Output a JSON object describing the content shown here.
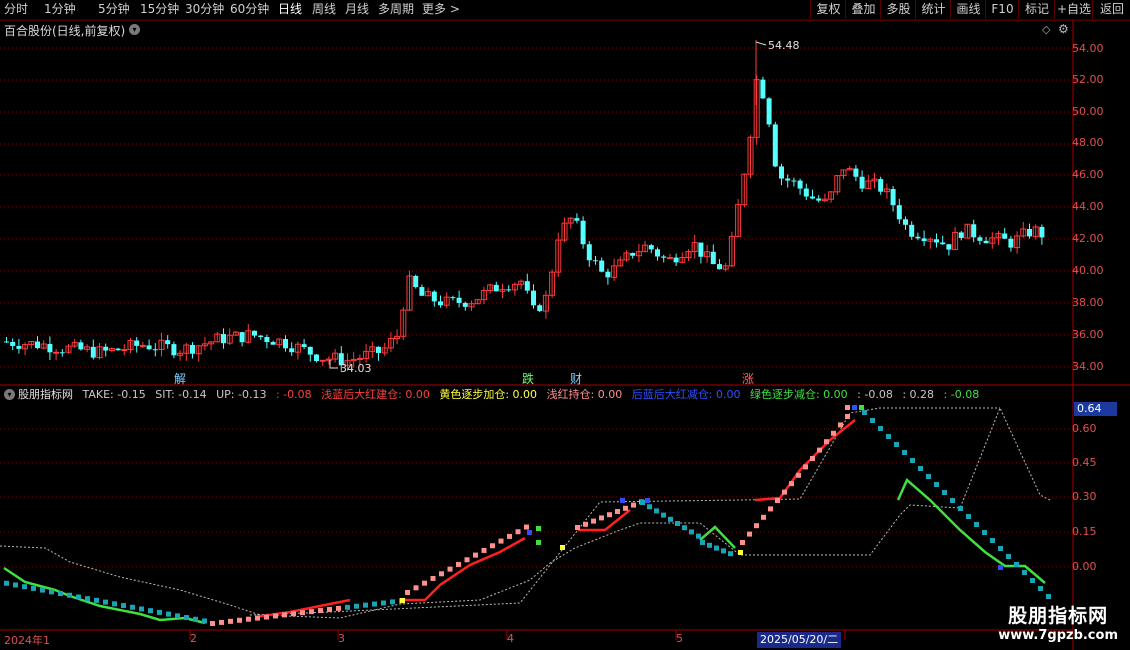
{
  "toolbar": {
    "periods": [
      "分时",
      "1分钟",
      "5分钟",
      "15分钟",
      "30分钟",
      "60分钟",
      "日线",
      "周线",
      "月线",
      "多周期",
      "更多 >"
    ],
    "buttons": [
      "复权",
      "叠加",
      "多股",
      "统计",
      "画线",
      "F10",
      "标记",
      "+自选",
      "返回"
    ]
  },
  "stock": {
    "title": "百合股份(日线,前复权)"
  },
  "price_axis": {
    "labels": [
      "54.00",
      "52.00",
      "50.00",
      "48.00",
      "46.00",
      "44.00",
      "42.00",
      "40.00",
      "38.00",
      "36.00",
      "34.00"
    ]
  },
  "indicator_axis": {
    "labels": [
      "0.60",
      "0.45",
      "0.30",
      "0.15",
      "0.00"
    ],
    "current": "0.64"
  },
  "annotations": {
    "high": "54.48",
    "low": "34.03"
  },
  "markers": [
    {
      "text": "解",
      "color": "#7fd0ff"
    },
    {
      "text": "跌",
      "color": "#70ff70"
    },
    {
      "text": "财",
      "color": "#7fd0ff"
    },
    {
      "text": "涨",
      "color": "#ff6060"
    }
  ],
  "indicator": {
    "name": "股朋指标网",
    "items": [
      {
        "text": "TAKE: -0.15",
        "color": "#c8c8c8"
      },
      {
        "text": "SIT: -0.14",
        "color": "#c8c8c8"
      },
      {
        "text": "UP: -0.13",
        "color": "#c8c8c8"
      },
      {
        "text": ": -0.08",
        "color": "#ff4040"
      },
      {
        "text": "浅蓝后大红建仓: 0.00",
        "color": "#ff4040"
      },
      {
        "text": "黄色逐步加仓: 0.00",
        "color": "#ffff40"
      },
      {
        "text": "浅红持仓: 0.00",
        "color": "#ff9090"
      },
      {
        "text": "后蓝后大红减仓: 0.00",
        "color": "#3050ff"
      },
      {
        "text": "绿色逐步减仓: 0.00",
        "color": "#40e040"
      },
      {
        "text": ": -0.08",
        "color": "#c8c8c8"
      },
      {
        "text": ": 0.28",
        "color": "#c8c8c8"
      },
      {
        "text": ": -0.08",
        "color": "#40e040"
      }
    ]
  },
  "x_axis": {
    "labels": [
      "2024年1",
      "2",
      "3",
      "4",
      "5"
    ],
    "selected_date": "2025/05/20/二"
  },
  "watermark": {
    "title": "股朋指标网",
    "url": "www.7gpzb.com"
  },
  "colors": {
    "up": "#ff3a3a",
    "down": "#54ffff",
    "grid": "#8a0000",
    "bg": "#000000"
  }
}
